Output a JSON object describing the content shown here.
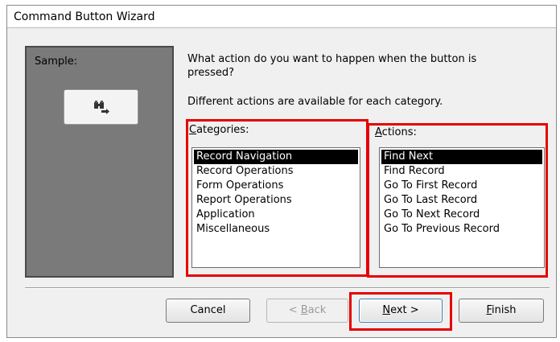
{
  "window": {
    "title": "Command Button Wizard"
  },
  "sample": {
    "label": "Sample:",
    "icon": "binoculars-arrow-icon"
  },
  "prompt": {
    "question": "What action do you want to happen when the button is pressed?",
    "info": "Different actions are available for each category."
  },
  "categories": {
    "label_accel": "C",
    "label_rest": "ategories:",
    "selected": "Record Navigation",
    "items": [
      "Record Navigation",
      "Record Operations",
      "Form Operations",
      "Report Operations",
      "Application",
      "Miscellaneous"
    ]
  },
  "actions": {
    "label_accel": "A",
    "label_rest": "ctions:",
    "selected": "Find Next",
    "items": [
      "Find Next",
      "Find Record",
      "Go To First Record",
      "Go To Last Record",
      "Go To Next Record",
      "Go To Previous Record"
    ]
  },
  "buttons": {
    "cancel": "Cancel",
    "back_pre": "< ",
    "back_accel": "B",
    "back_rest": "ack",
    "next_accel": "N",
    "next_rest": "ext >",
    "finish_accel": "F",
    "finish_rest": "inish"
  },
  "colors": {
    "highlight": "#e60000",
    "selection": "#000000"
  }
}
